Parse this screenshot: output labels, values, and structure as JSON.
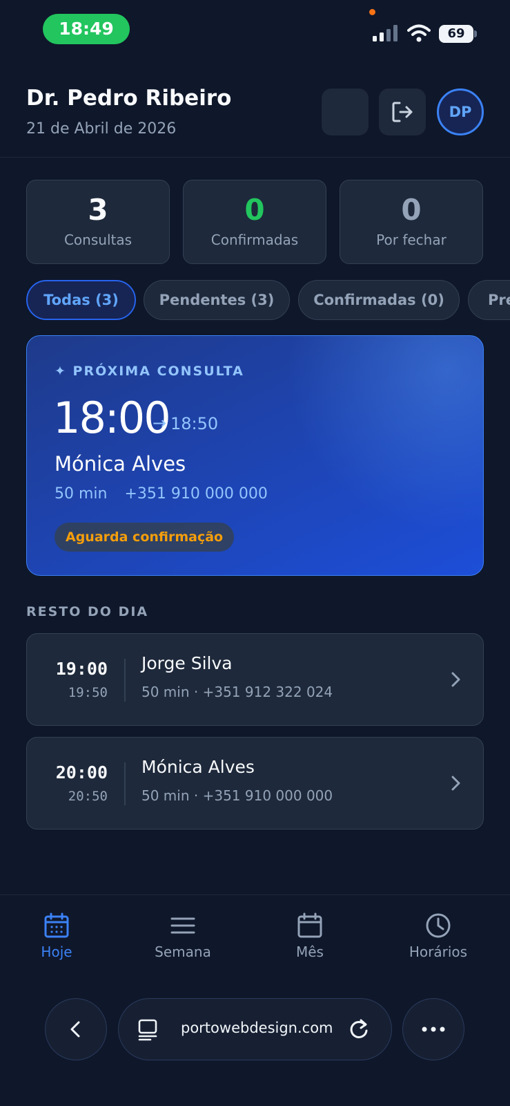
{
  "status_bar": {
    "time": "18:49",
    "battery": "69",
    "icons": [
      "signal-icon",
      "wifi-icon",
      "battery-icon"
    ]
  },
  "header": {
    "name": "Dr. Pedro Ribeiro",
    "date": "21 de Abril de 2026",
    "avatar_initials": "DP",
    "logout_icon": "logout-icon"
  },
  "stats": [
    {
      "value": "3",
      "label": "Consultas"
    },
    {
      "value": "0",
      "label": "Confirmadas"
    },
    {
      "value": "0",
      "label": "Por fechar"
    }
  ],
  "filters": [
    {
      "label": "Todas (3)",
      "active": true
    },
    {
      "label": "Pendentes (3)",
      "active": false
    },
    {
      "label": "Confirmadas (0)",
      "active": false
    },
    {
      "label": "Pre",
      "active": false
    }
  ],
  "next": {
    "label": "✦ PRÓXIMA CONSULTA",
    "start": "18:00",
    "arrow": "→",
    "end": "18:50",
    "patient": "Mónica Alves",
    "duration": "50 min",
    "phone": "+351 910 000 000",
    "badge": "Aguarda confirmação"
  },
  "rest_title": "RESTO DO DIA",
  "appointments": [
    {
      "start": "19:00",
      "end": "19:50",
      "name": "Jorge Silva",
      "meta": "50 min · +351 912 322 024"
    },
    {
      "start": "20:00",
      "end": "20:50",
      "name": "Mónica Alves",
      "meta": "50 min · +351 910 000 000"
    }
  ],
  "nav": [
    {
      "label": "Hoje",
      "icon": "calendar-day-icon",
      "active": true
    },
    {
      "label": "Semana",
      "icon": "list-icon",
      "active": false
    },
    {
      "label": "Mês",
      "icon": "calendar-icon",
      "active": false
    },
    {
      "label": "Horários",
      "icon": "clock-icon",
      "active": false
    }
  ],
  "browser": {
    "url": "portowebdesign.com",
    "icons": [
      "back-icon",
      "reader-icon",
      "reload-icon",
      "more-icon"
    ]
  },
  "colors": {
    "background": "#0f172a",
    "card": "#1e293b",
    "accent": "#3b82f6",
    "success": "#22c55e",
    "warning": "#f59e0b"
  }
}
